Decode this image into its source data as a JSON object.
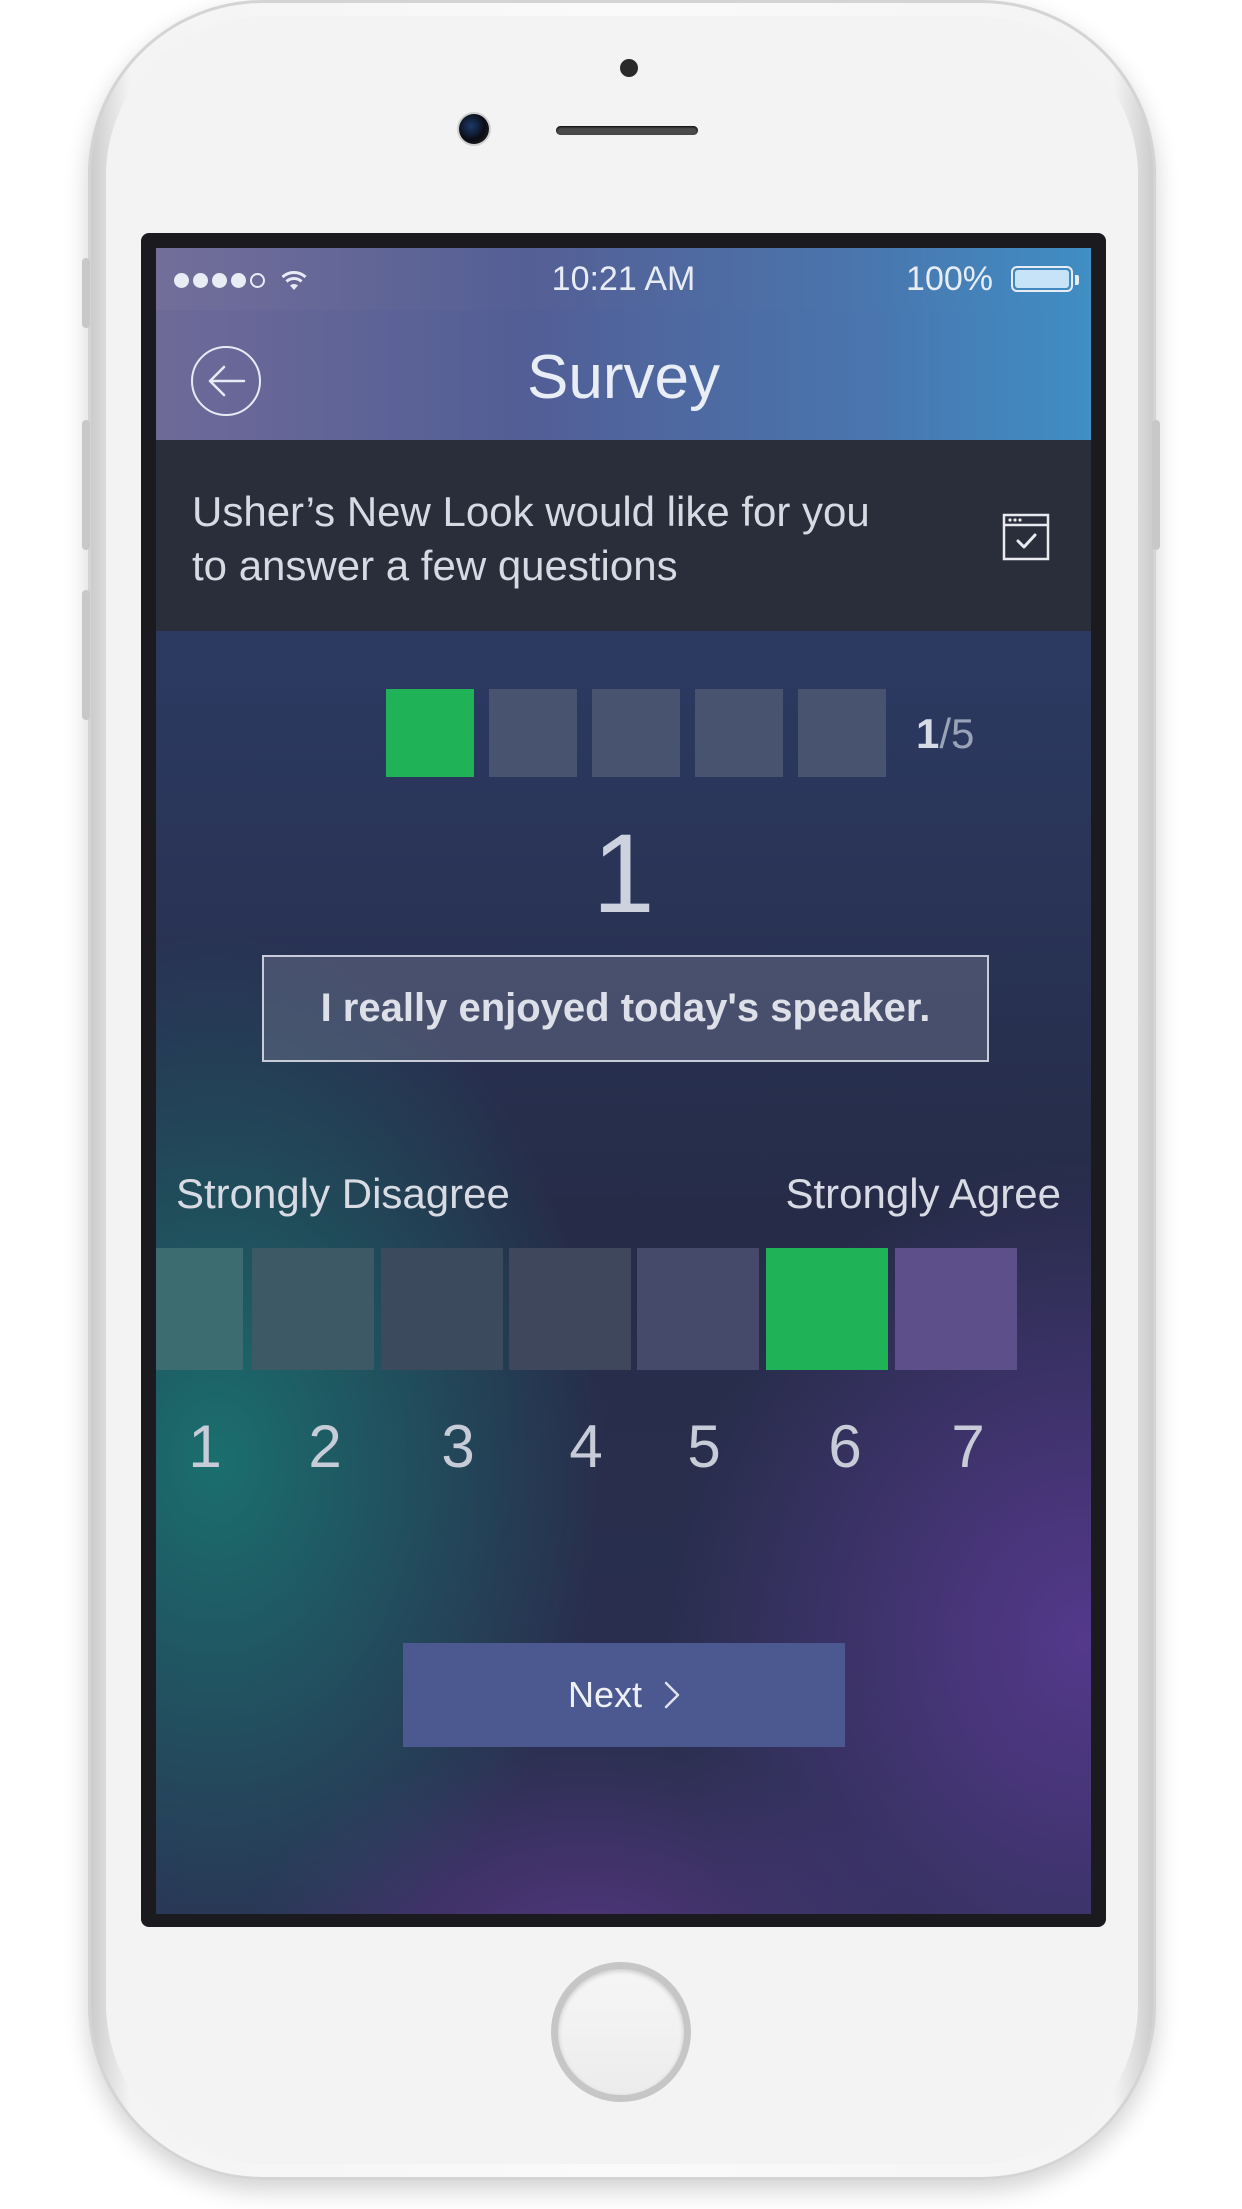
{
  "status_bar": {
    "time": "10:21 AM",
    "battery": "100%"
  },
  "nav": {
    "title": "Survey"
  },
  "banner": {
    "message": "Usher’s New Look would like for you to answer a few questions"
  },
  "progress": {
    "current": "1",
    "total": "/5",
    "fraction": 0.2
  },
  "question": {
    "number": "1",
    "text": "I really enjoyed today's speaker."
  },
  "scale": {
    "label_left": "Strongly Disagree",
    "label_right": "Strongly Agree",
    "options": [
      "1",
      "2",
      "3",
      "4",
      "5",
      "6",
      "7"
    ],
    "selected": "6",
    "colors": [
      "#3d6c70",
      "#3d5966",
      "#3c4a5e",
      "#3e475c",
      "#45496a",
      "#1fb257",
      "#5d4f8a"
    ]
  },
  "actions": {
    "next_label": "Next"
  },
  "accent": "#1fb257"
}
